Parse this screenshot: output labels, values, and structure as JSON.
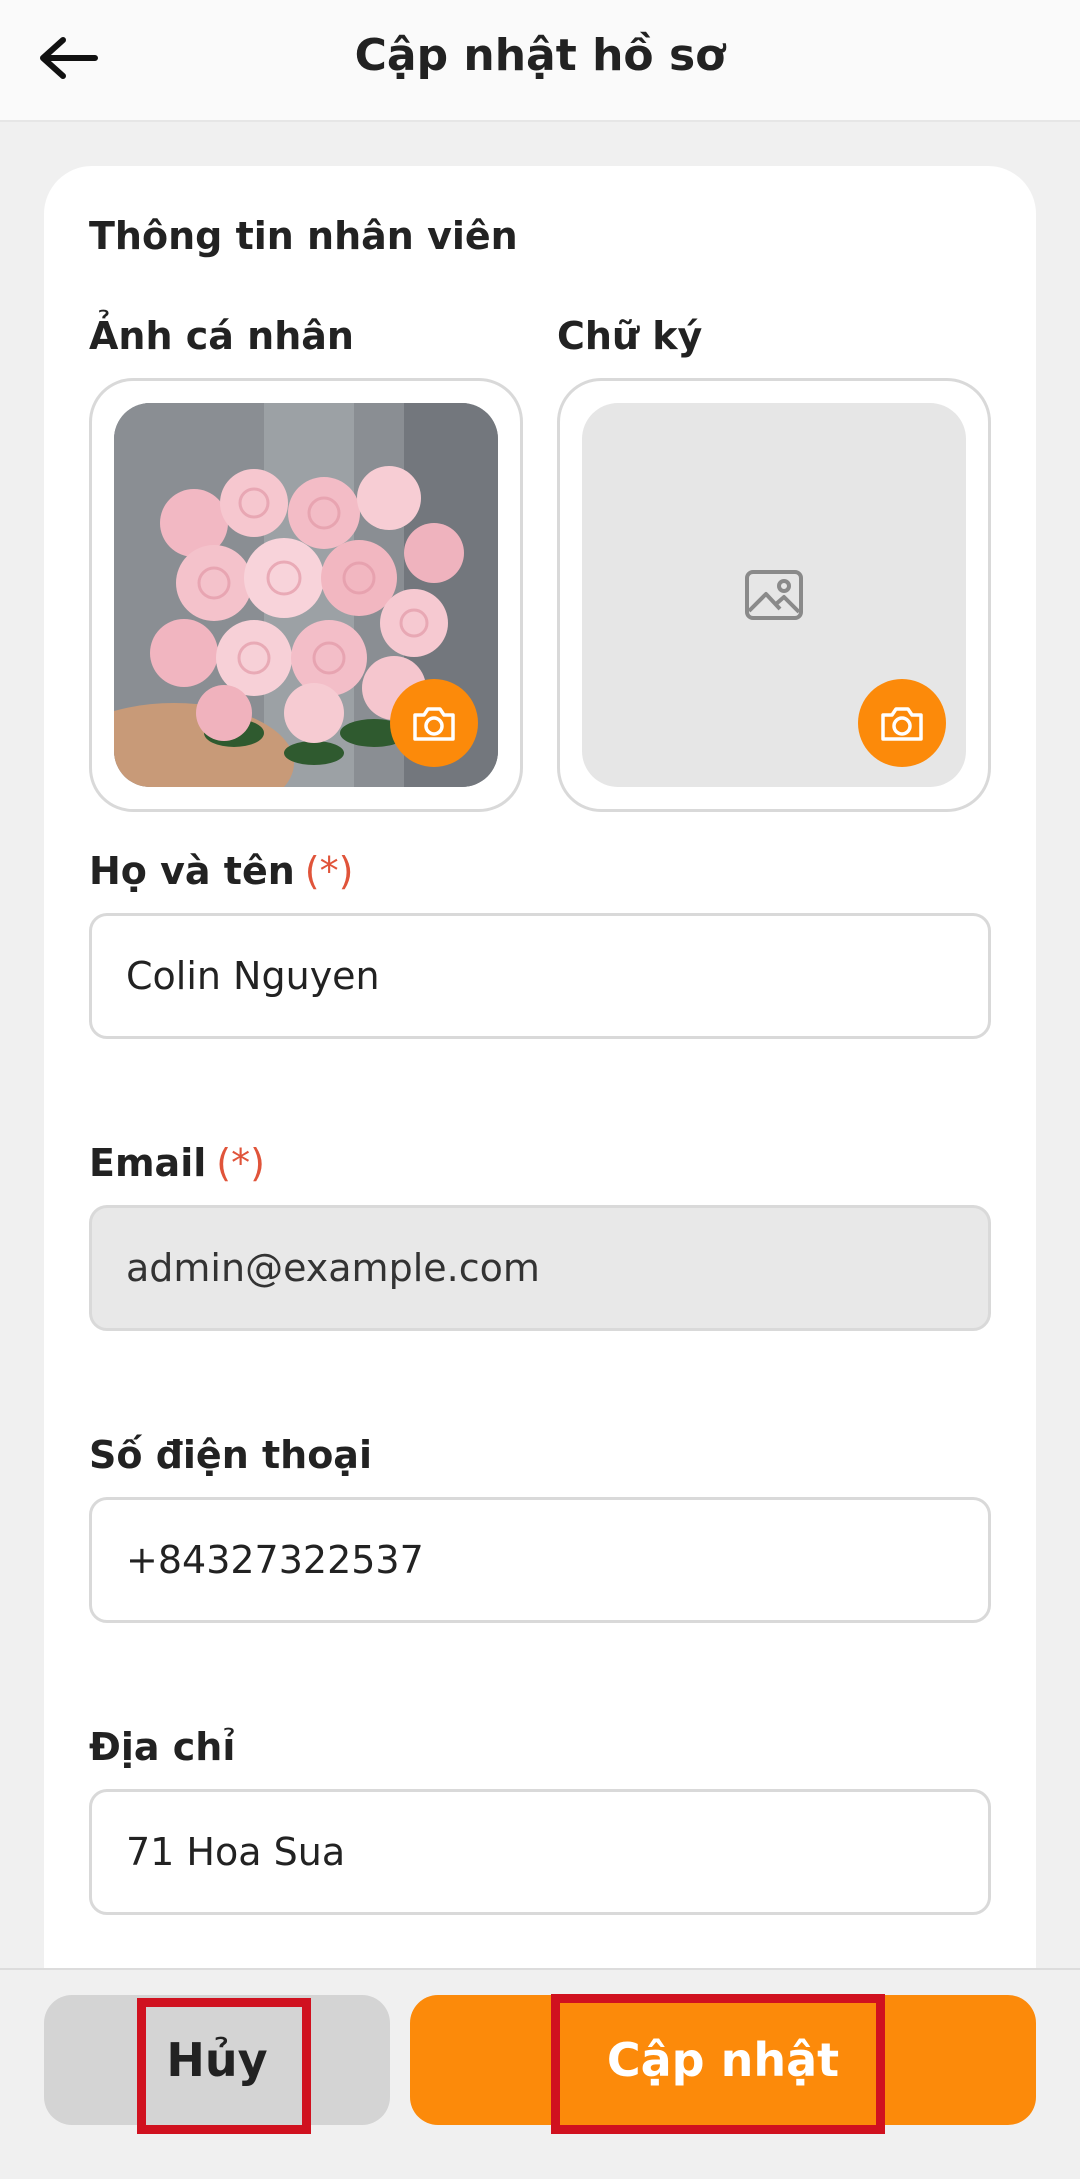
{
  "header": {
    "title": "Cập nhật hồ sơ",
    "back_icon": "arrow-left-icon"
  },
  "profile": {
    "section_title": "Thông tin nhân viên",
    "avatar_label": "Ảnh cá nhân",
    "signature_label": "Chữ ký",
    "camera_icon": "camera-icon",
    "placeholder_icon": "image-placeholder-icon",
    "accent_color": "#fc8a0a"
  },
  "form": {
    "required_mark": "(*)",
    "fields": [
      {
        "label": "Họ và tên",
        "required": true,
        "value": "Colin Nguyen",
        "disabled": false
      },
      {
        "label": "Email",
        "required": true,
        "value": "admin@example.com",
        "disabled": true
      },
      {
        "label": "Số điện thoại",
        "required": false,
        "value": "+84327322537",
        "disabled": false
      },
      {
        "label": "Địa chỉ",
        "required": false,
        "value": "71 Hoa Sua",
        "disabled": false
      }
    ]
  },
  "actions": {
    "cancel_label": "Hủy",
    "update_label": "Cập nhật",
    "highlight_color": "#d0111f"
  }
}
